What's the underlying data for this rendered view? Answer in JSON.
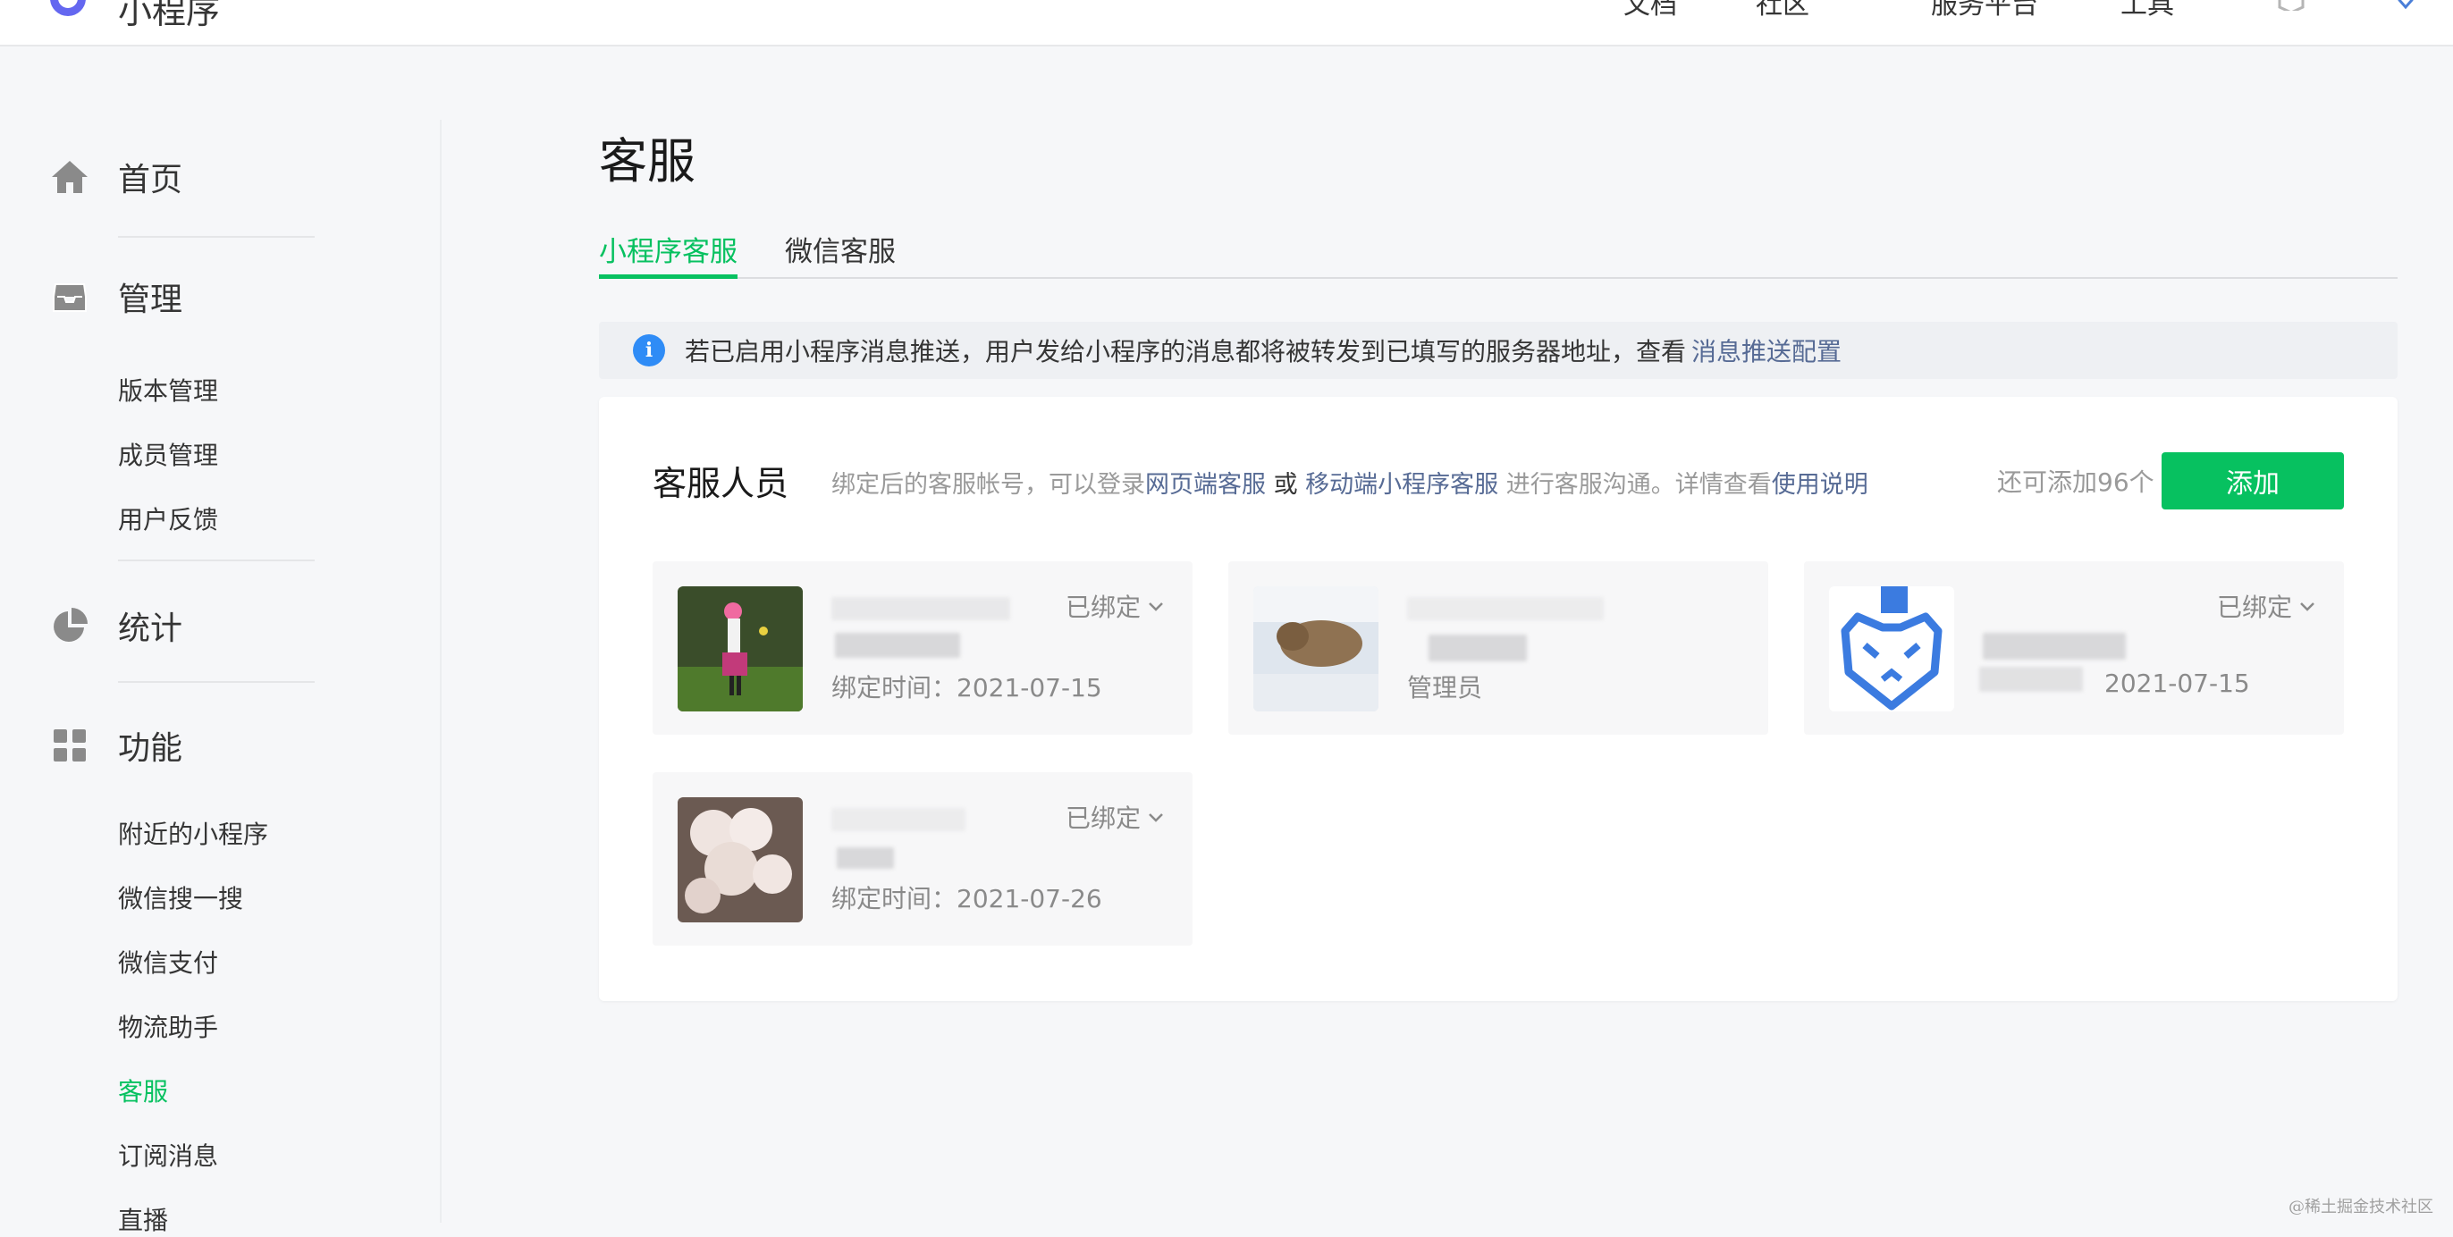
{
  "topbar": {
    "brand": "小程序",
    "nav": [
      "文档",
      "社区",
      "服务平台",
      "工具"
    ]
  },
  "sidebar": {
    "sections": [
      {
        "label": "首页",
        "icon": "home-icon"
      },
      {
        "label": "管理",
        "icon": "inbox-icon",
        "items": [
          "版本管理",
          "成员管理",
          "用户反馈"
        ]
      },
      {
        "label": "统计",
        "icon": "pie-chart-icon"
      },
      {
        "label": "功能",
        "icon": "grid-icon",
        "items": [
          "附近的小程序",
          "微信搜一搜",
          "微信支付",
          "物流助手",
          "客服",
          "订阅消息",
          "直播"
        ]
      }
    ],
    "active_item": "客服"
  },
  "main": {
    "title": "客服",
    "tabs": [
      "小程序客服",
      "微信客服"
    ],
    "active_tab": "小程序客服",
    "notice": {
      "text": "若已启用小程序消息推送，用户发给小程序的消息都将被转发到已填写的服务器地址，查看",
      "link": "消息推送配置"
    },
    "panel": {
      "title": "客服人员",
      "desc_prefix": "绑定后的客服帐号，可以登录",
      "desc_link1": "网页端客服",
      "desc_or": " 或 ",
      "desc_link2": "移动端小程序客服",
      "desc_mid": " 进行客服沟通。详情查看",
      "desc_link3": "使用说明",
      "remaining": "还可添加96个",
      "add_label": "添加",
      "cards": [
        {
          "status": "已绑定",
          "bind_time": "绑定时间：2021-07-15"
        },
        {
          "role": "管理员"
        },
        {
          "status": "已绑定",
          "bind_time": "2021-07-15"
        },
        {
          "status": "已绑定",
          "bind_time": "绑定时间：2021-07-26"
        }
      ]
    }
  },
  "watermark": "@稀土掘金技术社区"
}
